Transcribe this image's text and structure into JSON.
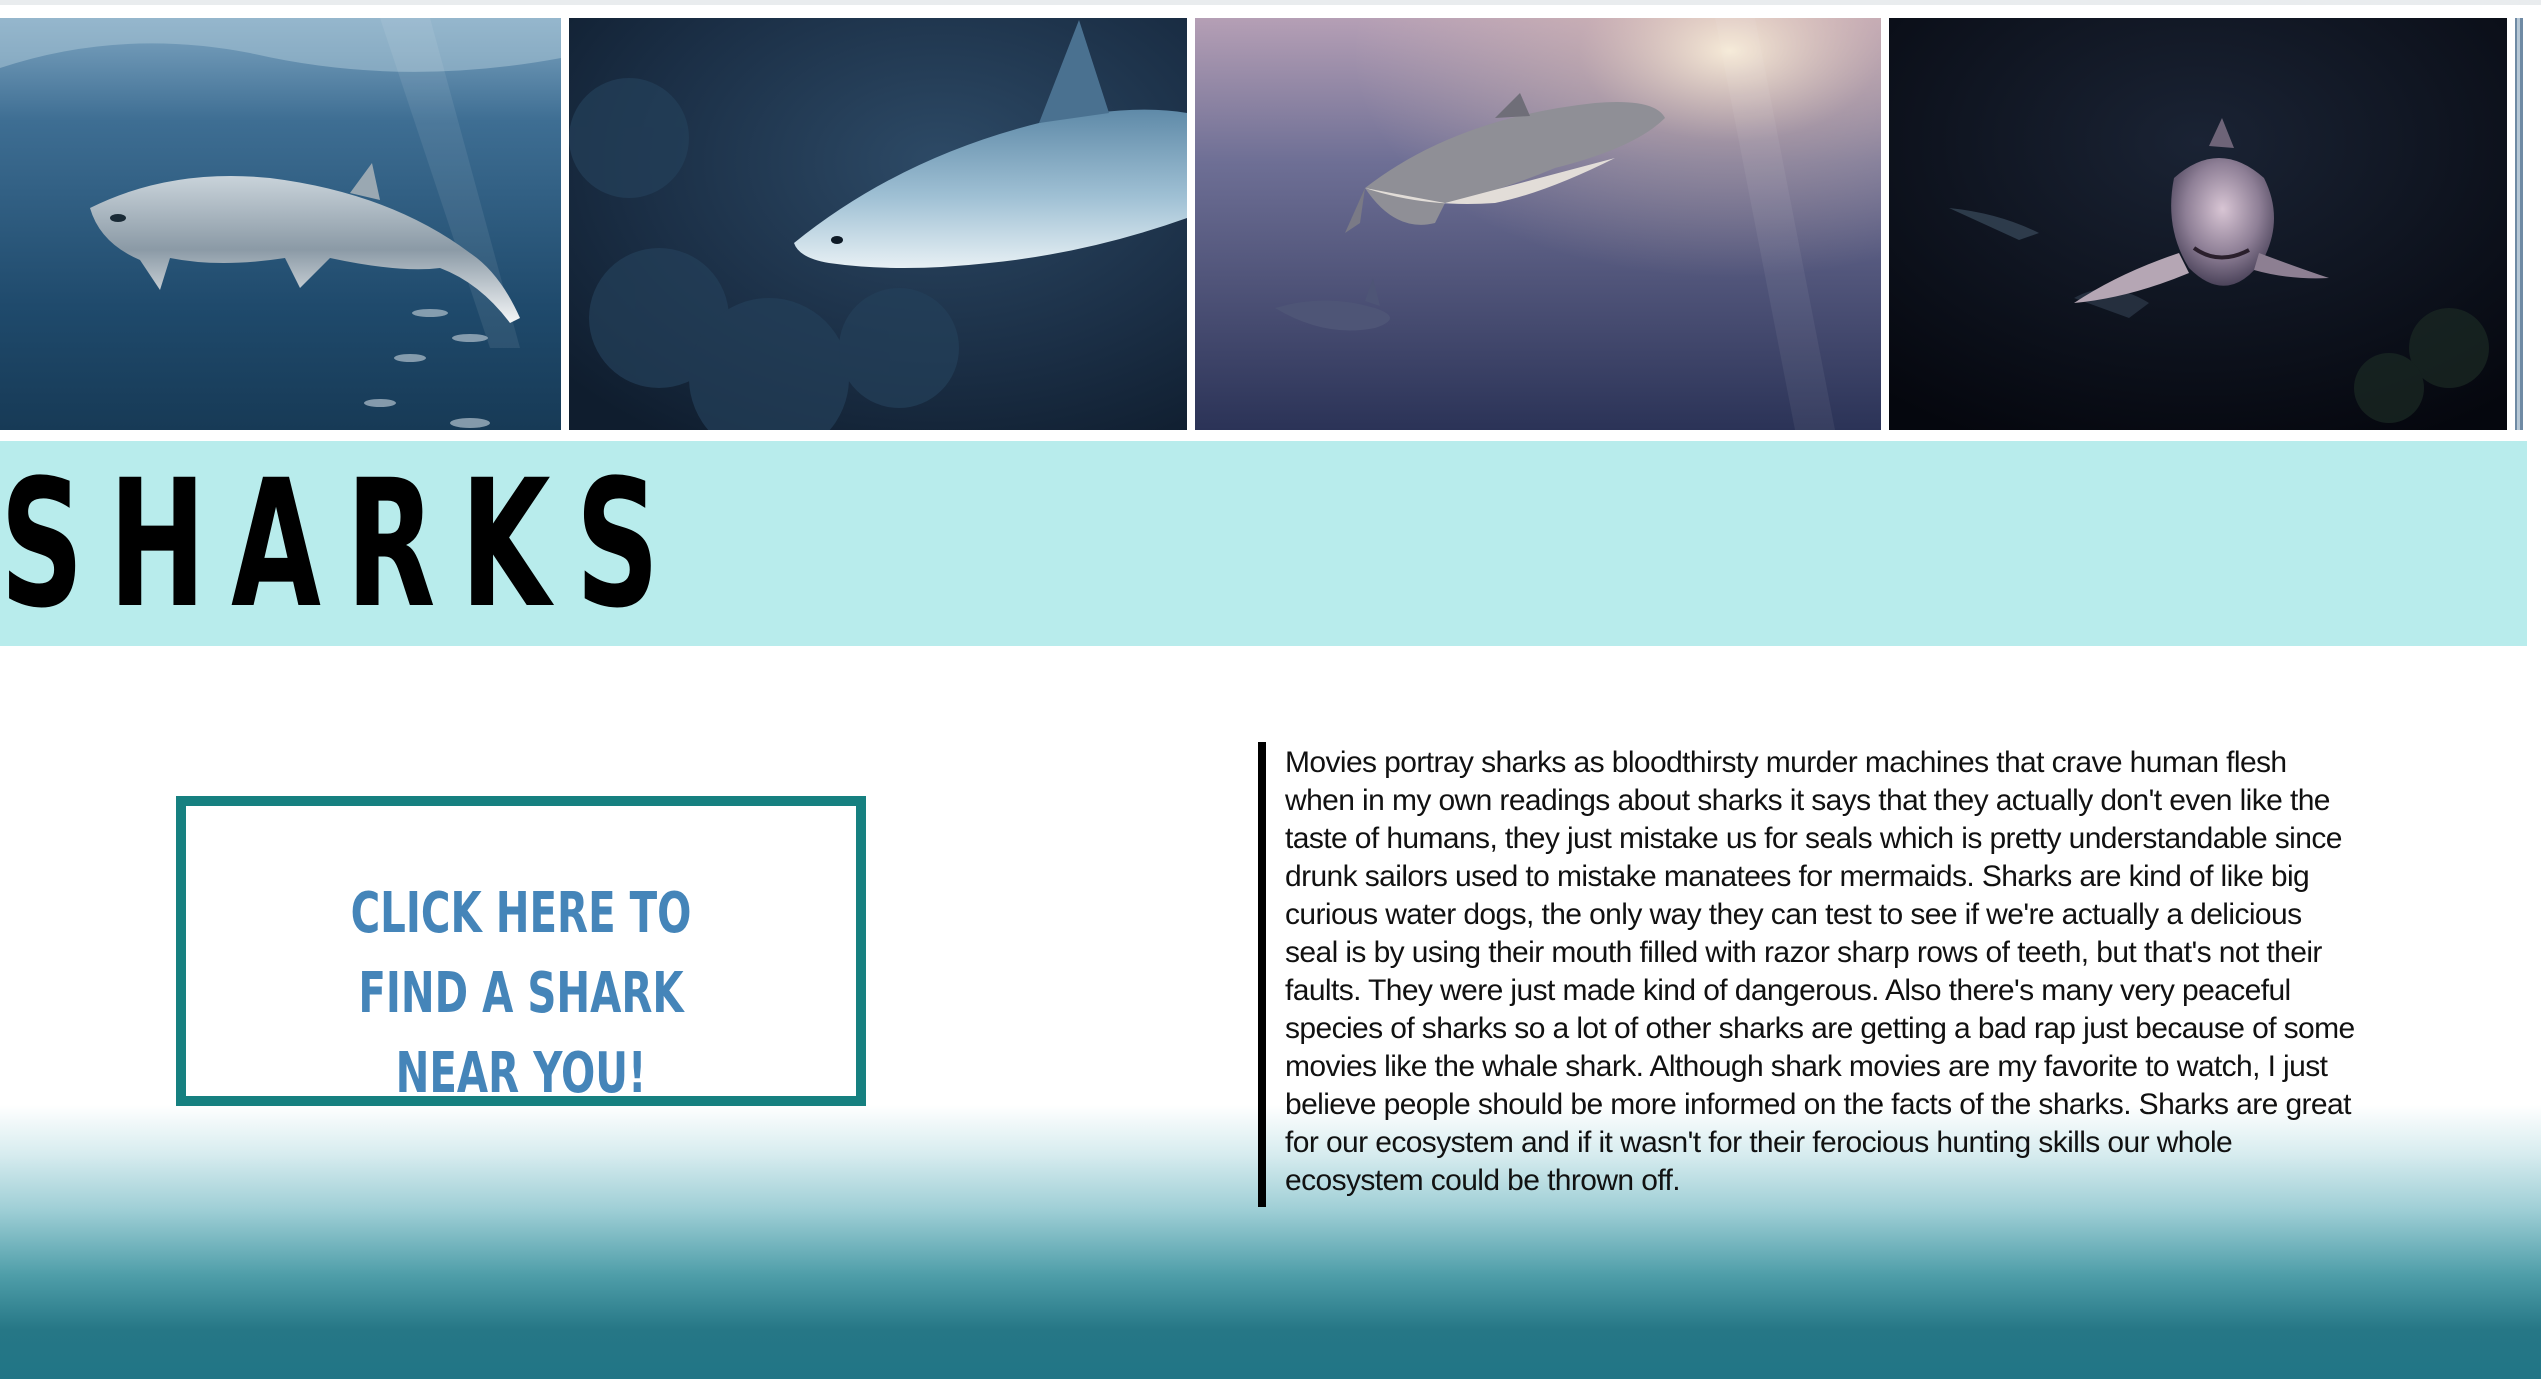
{
  "title": "SHARKS",
  "cta": {
    "label": "CLICK HERE TO FIND A SHARK NEAR YOU!"
  },
  "article": {
    "text": "Movies portray sharks as bloodthirsty murder machines that crave human flesh when in my own readings about sharks it says that they actually don't even like the taste of humans, they just mistake us for seals which is pretty understandable since drunk sailors used to mistake manatees for mermaids. Sharks are kind of like big curious water dogs, the only way they can test to see if we're actually a delicious seal is by using their mouth filled with razor sharp rows of teeth, but that's not their faults. They were just made kind of dangerous. Also there's many very peaceful species of sharks so a lot of other sharks are getting a bad rap just because of some movies like the whale shark. Although shark movies are my favorite to watch, I just believe people should be more informed on the facts of the sharks. Sharks are great for our ecosystem and if it wasn't for their ferocious hunting skills our whole ecosystem could be thrown off."
  },
  "photos": [
    {
      "name": "great-white-shark-photo"
    },
    {
      "name": "reef-shark-photo"
    },
    {
      "name": "tiger-shark-photo"
    },
    {
      "name": "sand-tiger-shark-photo"
    },
    {
      "name": "partial-photo"
    }
  ],
  "colors": {
    "title_band": "#b8ecec",
    "cta_border": "#168080",
    "cta_text": "#4585b9",
    "sea": "#217586"
  }
}
